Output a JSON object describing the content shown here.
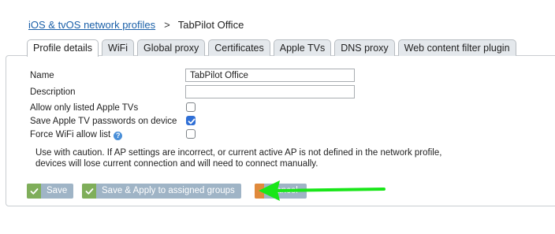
{
  "breadcrumb": {
    "parent_label": "iOS & tvOS network profiles",
    "separator": ">",
    "current": "TabPilot Office"
  },
  "tabs": [
    {
      "label": "Profile details",
      "active": true
    },
    {
      "label": "WiFi",
      "active": false
    },
    {
      "label": "Global proxy",
      "active": false
    },
    {
      "label": "Certificates",
      "active": false
    },
    {
      "label": "Apple TVs",
      "active": false
    },
    {
      "label": "DNS proxy",
      "active": false
    },
    {
      "label": "Web content filter plugin",
      "active": false
    }
  ],
  "form": {
    "name_label": "Name",
    "name_value": "TabPilot Office",
    "description_label": "Description",
    "description_value": "",
    "allow_listed_label": "Allow only listed Apple TVs",
    "allow_listed_checked": false,
    "save_passwords_label": "Save Apple TV passwords on device",
    "save_passwords_checked": true,
    "force_wifi_label": "Force WiFi allow list",
    "force_wifi_checked": false,
    "help_icon": "question-icon",
    "caution_text": "Use with caution. If AP settings are incorrect, or current active AP is not defined in the network profile, devices will lose current connection and will need to connect manually."
  },
  "buttons": {
    "save_label": "Save",
    "apply_label": "Save & Apply to assigned groups",
    "cancel_label": "Cancel",
    "check_icon": "check-icon",
    "cancel_icon": "x-icon"
  },
  "annotation": {
    "arrow_color": "#19e619",
    "arrow_icon": "green-arrow-icon"
  },
  "colors": {
    "link": "#1a5fa8",
    "checkbox_checked": "#2f6fd6",
    "button_disabled": "#9fb4c6"
  }
}
